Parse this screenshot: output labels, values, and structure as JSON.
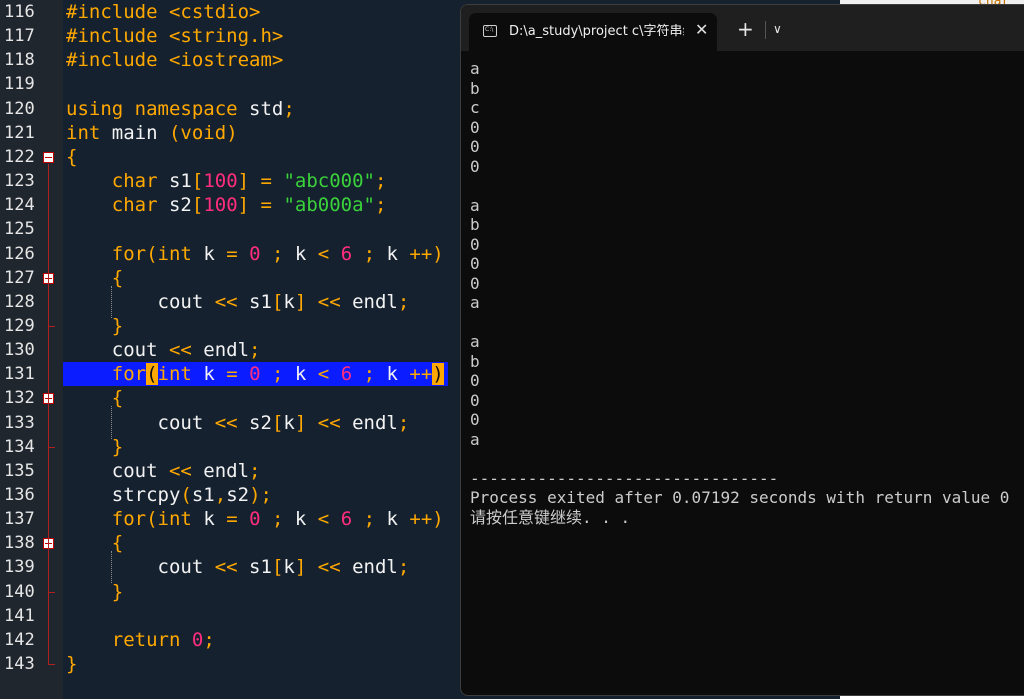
{
  "editor": {
    "lines": [
      {
        "n": "116",
        "tokens": [
          [
            "pp",
            "#include <cstdio>"
          ]
        ]
      },
      {
        "n": "117",
        "tokens": [
          [
            "pp",
            "#include <string.h>"
          ]
        ]
      },
      {
        "n": "118",
        "tokens": [
          [
            "pp",
            "#include <iostream>"
          ]
        ]
      },
      {
        "n": "119",
        "tokens": []
      },
      {
        "n": "120",
        "tokens": [
          [
            "kw",
            "using namespace"
          ],
          [
            "txt",
            " std"
          ],
          [
            "op",
            ";"
          ]
        ]
      },
      {
        "n": "121",
        "tokens": [
          [
            "ty",
            "int"
          ],
          [
            "txt",
            " main "
          ],
          [
            "op",
            "("
          ],
          [
            "ty",
            "void"
          ],
          [
            "op",
            ")"
          ]
        ]
      },
      {
        "n": "122",
        "tokens": [
          [
            "brace",
            "{"
          ]
        ],
        "fold": true
      },
      {
        "n": "123",
        "tokens": [
          [
            "txt",
            "    "
          ],
          [
            "ty",
            "char"
          ],
          [
            "txt",
            " s1"
          ],
          [
            "op",
            "["
          ],
          [
            "num",
            "100"
          ],
          [
            "op",
            "]"
          ],
          [
            "txt",
            " "
          ],
          [
            "op",
            "="
          ],
          [
            "txt",
            " "
          ],
          [
            "str",
            "\"abc000\""
          ],
          [
            "op",
            ";"
          ]
        ]
      },
      {
        "n": "124",
        "tokens": [
          [
            "txt",
            "    "
          ],
          [
            "ty",
            "char"
          ],
          [
            "txt",
            " s2"
          ],
          [
            "op",
            "["
          ],
          [
            "num",
            "100"
          ],
          [
            "op",
            "]"
          ],
          [
            "txt",
            " "
          ],
          [
            "op",
            "="
          ],
          [
            "txt",
            " "
          ],
          [
            "str",
            "\"ab000a\""
          ],
          [
            "op",
            ";"
          ]
        ]
      },
      {
        "n": "125",
        "tokens": []
      },
      {
        "n": "126",
        "tokens": [
          [
            "txt",
            "    "
          ],
          [
            "kw",
            "for"
          ],
          [
            "op",
            "("
          ],
          [
            "ty",
            "int"
          ],
          [
            "txt",
            " k "
          ],
          [
            "op",
            "="
          ],
          [
            "txt",
            " "
          ],
          [
            "num",
            "0"
          ],
          [
            "txt",
            " "
          ],
          [
            "op",
            ";"
          ],
          [
            "txt",
            " k "
          ],
          [
            "op",
            "<"
          ],
          [
            "txt",
            " "
          ],
          [
            "num",
            "6"
          ],
          [
            "txt",
            " "
          ],
          [
            "op",
            ";"
          ],
          [
            "txt",
            " k "
          ],
          [
            "op",
            "++)"
          ]
        ]
      },
      {
        "n": "127",
        "tokens": [
          [
            "txt",
            "    "
          ],
          [
            "brace",
            "{"
          ]
        ],
        "fold": true
      },
      {
        "n": "128",
        "tokens": [
          [
            "txt",
            "        cout "
          ],
          [
            "op",
            "<<"
          ],
          [
            "txt",
            " s1"
          ],
          [
            "op",
            "["
          ],
          [
            "txt",
            "k"
          ],
          [
            "op",
            "]"
          ],
          [
            "txt",
            " "
          ],
          [
            "op",
            "<<"
          ],
          [
            "txt",
            " endl"
          ],
          [
            "op",
            ";"
          ]
        ]
      },
      {
        "n": "129",
        "tokens": [
          [
            "txt",
            "    "
          ],
          [
            "brace",
            "}"
          ]
        ]
      },
      {
        "n": "130",
        "tokens": [
          [
            "txt",
            "    cout "
          ],
          [
            "op",
            "<<"
          ],
          [
            "txt",
            " endl"
          ],
          [
            "op",
            ";"
          ]
        ]
      },
      {
        "n": "131",
        "tokens": [
          [
            "txt",
            "    "
          ],
          [
            "kw",
            "for"
          ],
          [
            "match",
            "("
          ],
          [
            "ty",
            "int"
          ],
          [
            "txt",
            " k "
          ],
          [
            "op",
            "="
          ],
          [
            "txt",
            " "
          ],
          [
            "num",
            "0"
          ],
          [
            "txt",
            " "
          ],
          [
            "op",
            ";"
          ],
          [
            "txt",
            " k "
          ],
          [
            "op",
            "<"
          ],
          [
            "txt",
            " "
          ],
          [
            "num",
            "6"
          ],
          [
            "txt",
            " "
          ],
          [
            "op",
            ";"
          ],
          [
            "txt",
            " k "
          ],
          [
            "op",
            "++"
          ],
          [
            "match",
            ")"
          ]
        ],
        "highlight": true
      },
      {
        "n": "132",
        "tokens": [
          [
            "txt",
            "    "
          ],
          [
            "brace",
            "{"
          ]
        ],
        "fold": true
      },
      {
        "n": "133",
        "tokens": [
          [
            "txt",
            "        cout "
          ],
          [
            "op",
            "<<"
          ],
          [
            "txt",
            " s2"
          ],
          [
            "op",
            "["
          ],
          [
            "txt",
            "k"
          ],
          [
            "op",
            "]"
          ],
          [
            "txt",
            " "
          ],
          [
            "op",
            "<<"
          ],
          [
            "txt",
            " endl"
          ],
          [
            "op",
            ";"
          ]
        ]
      },
      {
        "n": "134",
        "tokens": [
          [
            "txt",
            "    "
          ],
          [
            "brace",
            "}"
          ]
        ]
      },
      {
        "n": "135",
        "tokens": [
          [
            "txt",
            "    cout "
          ],
          [
            "op",
            "<<"
          ],
          [
            "txt",
            " endl"
          ],
          [
            "op",
            ";"
          ]
        ]
      },
      {
        "n": "136",
        "tokens": [
          [
            "txt",
            "    strcpy"
          ],
          [
            "op",
            "("
          ],
          [
            "txt",
            "s1"
          ],
          [
            "op",
            ","
          ],
          [
            "txt",
            "s2"
          ],
          [
            "op",
            ");"
          ]
        ]
      },
      {
        "n": "137",
        "tokens": [
          [
            "txt",
            "    "
          ],
          [
            "kw",
            "for"
          ],
          [
            "op",
            "("
          ],
          [
            "ty",
            "int"
          ],
          [
            "txt",
            " k "
          ],
          [
            "op",
            "="
          ],
          [
            "txt",
            " "
          ],
          [
            "num",
            "0"
          ],
          [
            "txt",
            " "
          ],
          [
            "op",
            ";"
          ],
          [
            "txt",
            " k "
          ],
          [
            "op",
            "<"
          ],
          [
            "txt",
            " "
          ],
          [
            "num",
            "6"
          ],
          [
            "txt",
            " "
          ],
          [
            "op",
            ";"
          ],
          [
            "txt",
            " k "
          ],
          [
            "op",
            "++)"
          ]
        ]
      },
      {
        "n": "138",
        "tokens": [
          [
            "txt",
            "    "
          ],
          [
            "brace",
            "{"
          ]
        ],
        "fold": true
      },
      {
        "n": "139",
        "tokens": [
          [
            "txt",
            "        cout "
          ],
          [
            "op",
            "<<"
          ],
          [
            "txt",
            " s1"
          ],
          [
            "op",
            "["
          ],
          [
            "txt",
            "k"
          ],
          [
            "op",
            "]"
          ],
          [
            "txt",
            " "
          ],
          [
            "op",
            "<<"
          ],
          [
            "txt",
            " endl"
          ],
          [
            "op",
            ";"
          ]
        ]
      },
      {
        "n": "140",
        "tokens": [
          [
            "txt",
            "    "
          ],
          [
            "brace",
            "}"
          ]
        ]
      },
      {
        "n": "141",
        "tokens": []
      },
      {
        "n": "142",
        "tokens": [
          [
            "txt",
            "    "
          ],
          [
            "kw",
            "return"
          ],
          [
            "txt",
            " "
          ],
          [
            "num",
            "0"
          ],
          [
            "op",
            ";"
          ]
        ]
      },
      {
        "n": "143",
        "tokens": [
          [
            "brace",
            "}"
          ]
        ]
      }
    ]
  },
  "terminal": {
    "tab_title": "D:\\a_study\\project  c\\字符串组",
    "close_glyph": "✕",
    "new_tab_glyph": "+",
    "dropdown_glyph": "∨",
    "output": [
      "a",
      "b",
      "c",
      "0",
      "0",
      "0",
      "",
      "a",
      "b",
      "0",
      "0",
      "0",
      "a",
      "",
      "a",
      "b",
      "0",
      "0",
      "0",
      "a",
      "",
      "--------------------------------",
      "Process exited after 0.07192 seconds with return value 0",
      "请按任意键继续. . ."
    ]
  },
  "background_app": {
    "visible_text": "char"
  }
}
